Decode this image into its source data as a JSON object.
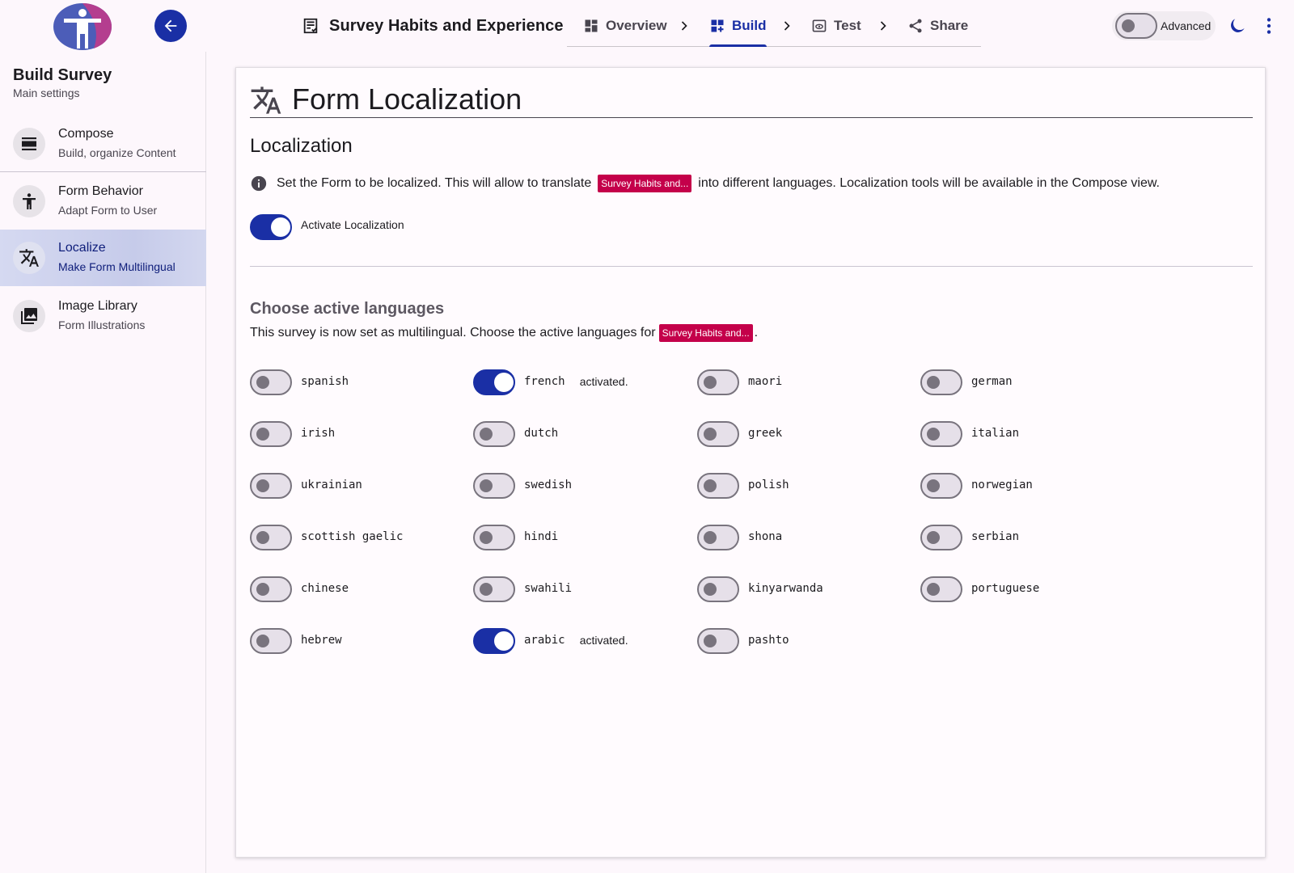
{
  "header": {
    "survey_title": "Survey Habits and Experience",
    "nav": [
      {
        "label": "Overview",
        "icon": "dashboard-icon"
      },
      {
        "label": "Build",
        "icon": "dashboard-add-icon"
      },
      {
        "label": "Test",
        "icon": "preview-icon"
      },
      {
        "label": "Share",
        "icon": "share-icon"
      }
    ],
    "advanced_label": "Advanced",
    "advanced_on": false,
    "accent_color": "#1a2fa5"
  },
  "sidebar": {
    "title": "Build Survey",
    "subtitle": "Main settings",
    "items": [
      {
        "label": "Compose",
        "desc": "Build, organize Content",
        "icon": "compose-icon"
      },
      {
        "label": "Form Behavior",
        "desc": "Adapt Form to User",
        "icon": "accessibility-icon"
      },
      {
        "label": "Localize",
        "desc": "Make Form Multilingual",
        "icon": "translate-icon"
      },
      {
        "label": "Image Library",
        "desc": "Form Illustrations",
        "icon": "image-library-icon"
      }
    ]
  },
  "main": {
    "title": "Form Localization",
    "section_title": "Localization",
    "info_before": "Set the Form to be localized. This will allow to translate",
    "info_chip": "Survey Habits and...",
    "info_after": "into different languages. Localization tools will be available in the Compose view.",
    "activate_label": "Activate Localization",
    "activate_on": true,
    "languages_title": "Choose active languages",
    "languages_desc_before": "This survey is now set as multilingual. Choose the active languages for",
    "languages_desc_chip": "Survey Habits and...",
    "languages_desc_after": ".",
    "activated_text": "activated.",
    "languages": [
      {
        "name": "spanish",
        "on": false
      },
      {
        "name": "french",
        "on": true
      },
      {
        "name": "maori",
        "on": false
      },
      {
        "name": "german",
        "on": false
      },
      {
        "name": "irish",
        "on": false
      },
      {
        "name": "dutch",
        "on": false
      },
      {
        "name": "greek",
        "on": false
      },
      {
        "name": "italian",
        "on": false
      },
      {
        "name": "ukrainian",
        "on": false
      },
      {
        "name": "swedish",
        "on": false
      },
      {
        "name": "polish",
        "on": false
      },
      {
        "name": "norwegian",
        "on": false
      },
      {
        "name": "scottish gaelic",
        "on": false
      },
      {
        "name": "hindi",
        "on": false
      },
      {
        "name": "shona",
        "on": false
      },
      {
        "name": "serbian",
        "on": false
      },
      {
        "name": "chinese",
        "on": false
      },
      {
        "name": "swahili",
        "on": false
      },
      {
        "name": "kinyarwanda",
        "on": false
      },
      {
        "name": "portuguese",
        "on": false
      },
      {
        "name": "hebrew",
        "on": false
      },
      {
        "name": "arabic",
        "on": true
      },
      {
        "name": "pashto",
        "on": false
      }
    ]
  }
}
